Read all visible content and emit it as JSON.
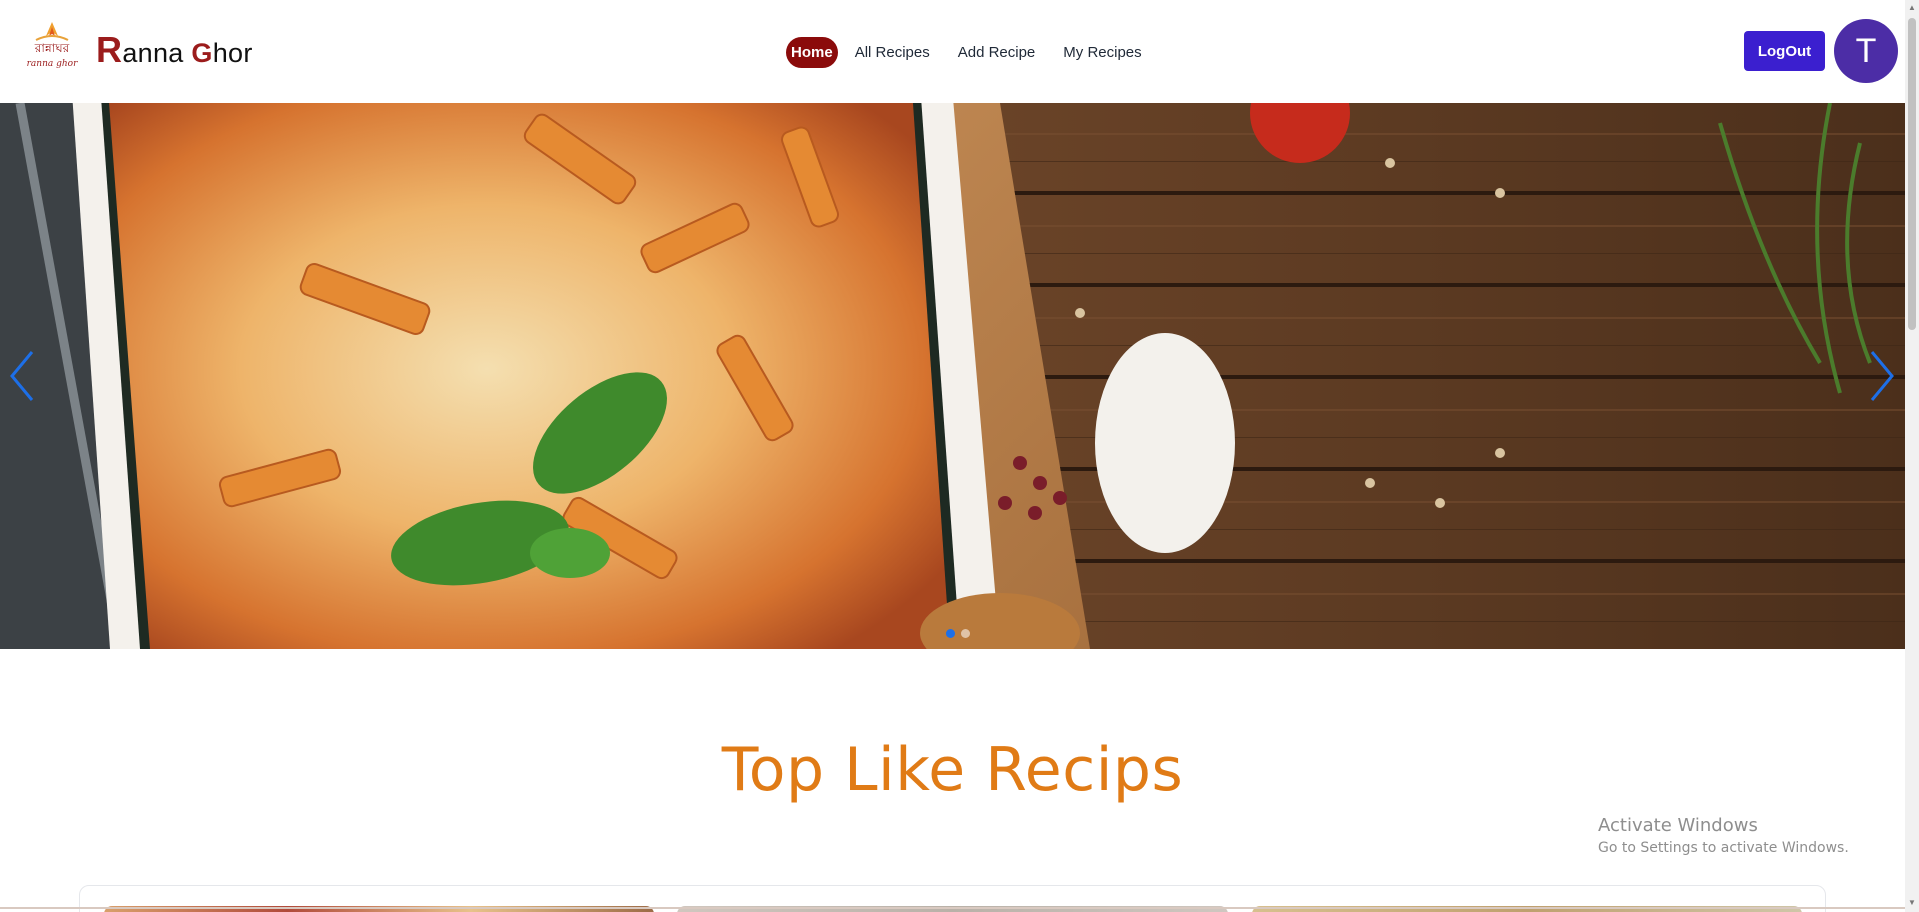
{
  "brand": {
    "logo_text": "রান্নাঘর",
    "logo_subtext": "ranna ghor",
    "name_cap1": "R",
    "name_rest1": "anna ",
    "name_cap2": "G",
    "name_rest2": "hor"
  },
  "nav": {
    "items": [
      {
        "label": "Home",
        "active": true
      },
      {
        "label": "All Recipes",
        "active": false
      },
      {
        "label": "Add Recipe",
        "active": false
      },
      {
        "label": "My Recipes",
        "active": false
      }
    ]
  },
  "user": {
    "logout_label": "LogOut",
    "avatar_initial": "T"
  },
  "carousel": {
    "prev_icon": "chevron-left-icon",
    "next_icon": "chevron-right-icon",
    "slide_count": 2,
    "active_slide": 1
  },
  "section": {
    "title": "Top Like Recips"
  },
  "watermark": {
    "line1": "Activate Windows",
    "line2": "Go to Settings to activate Windows."
  },
  "colors": {
    "brand_red": "#9b1c1c",
    "active_nav": "#8b0b0b",
    "logout_bg": "#3b1fcf",
    "avatar_bg": "#4c2da6",
    "section_title": "#e07b16",
    "carousel_accent": "#1d6fe8"
  }
}
